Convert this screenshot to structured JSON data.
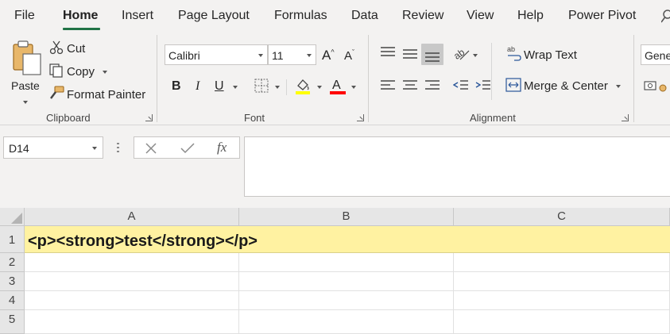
{
  "menu": {
    "tabs": [
      {
        "label": "File"
      },
      {
        "label": "Home"
      },
      {
        "label": "Insert"
      },
      {
        "label": "Page Layout"
      },
      {
        "label": "Formulas"
      },
      {
        "label": "Data"
      },
      {
        "label": "Review"
      },
      {
        "label": "View"
      },
      {
        "label": "Help"
      },
      {
        "label": "Power Pivot"
      }
    ],
    "active_tab": "Home",
    "accent_color": "#217346"
  },
  "ribbon": {
    "clipboard": {
      "label": "Clipboard",
      "paste": "Paste",
      "cut": "Cut",
      "copy": "Copy",
      "format_painter": "Format Painter"
    },
    "font": {
      "label": "Font",
      "font_name": "Calibri",
      "font_size": "11",
      "highlight_color": "#ffff00",
      "font_color": "#ff0000"
    },
    "alignment": {
      "label": "Alignment",
      "wrap_text": "Wrap Text",
      "merge_center": "Merge & Center"
    },
    "number": {
      "format": "Gene"
    }
  },
  "formula_bar": {
    "name_box": "D14",
    "fx_label": "fx",
    "content": ""
  },
  "sheet": {
    "columns": [
      "A",
      "B",
      "C"
    ],
    "rows": [
      "1",
      "2",
      "3",
      "4",
      "5"
    ],
    "cell_a1": "<p><strong>test</strong></p>",
    "row1_fill": "#fff2a1"
  }
}
